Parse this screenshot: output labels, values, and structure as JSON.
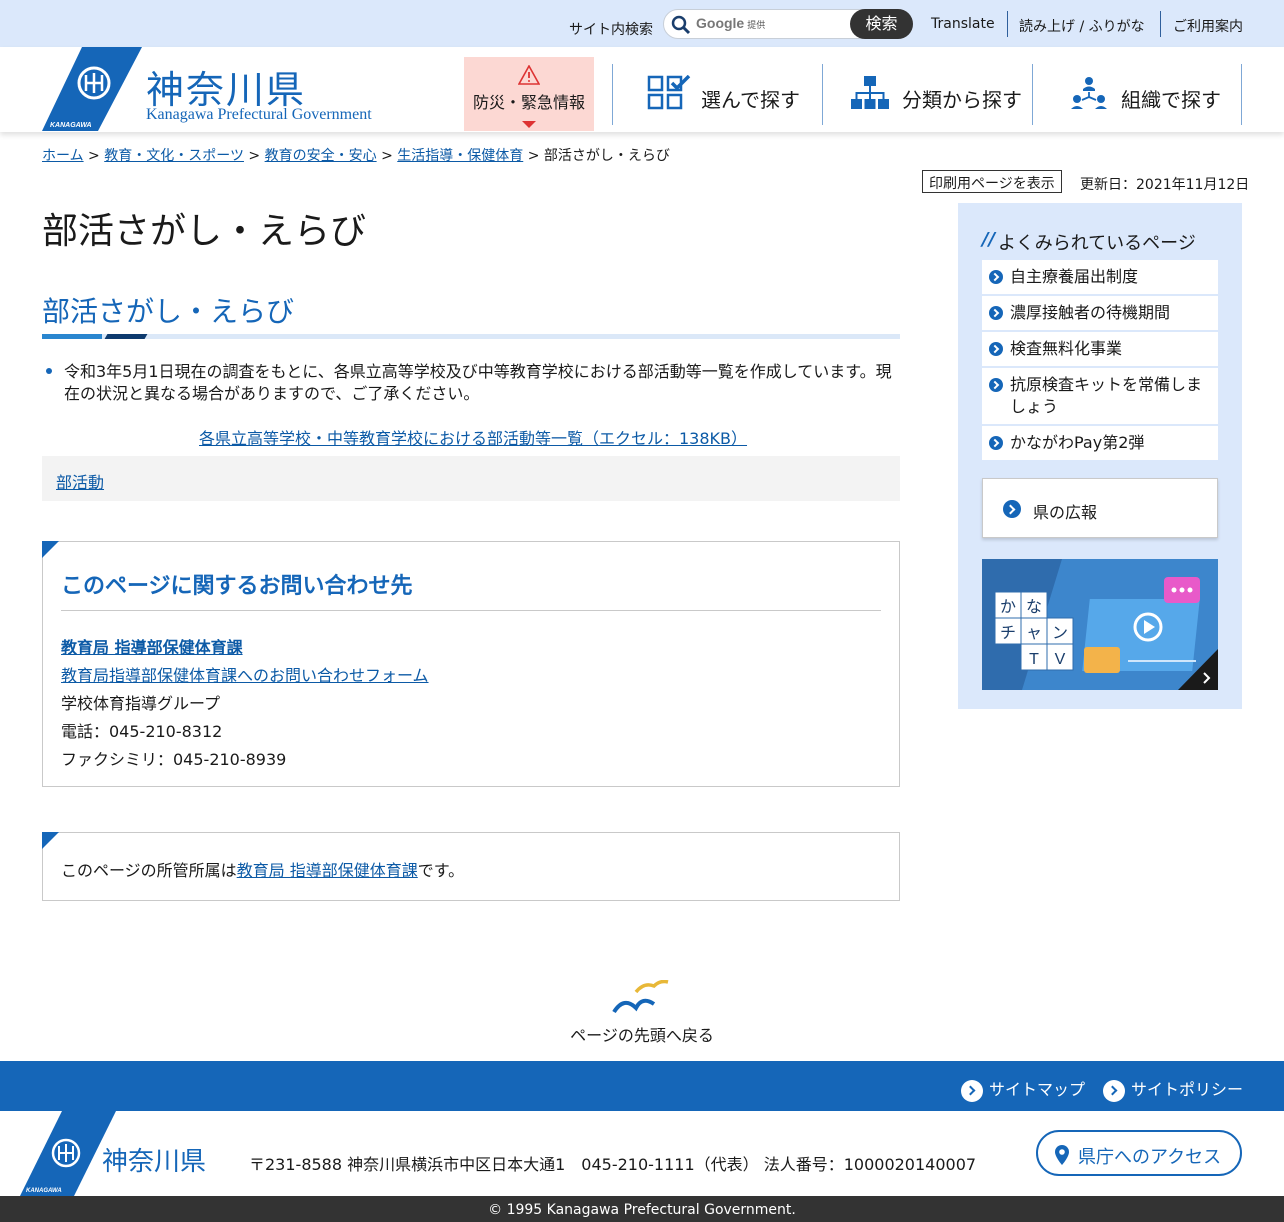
{
  "topbar": {
    "search_label": "サイト内検索",
    "search_provider": "Google",
    "search_provider_sub": "提供",
    "search_button": "検索",
    "translate": "Translate",
    "readaloud": "読み上げ / ふりがな",
    "guide": "ご利用案内"
  },
  "header": {
    "logo_jp": "神奈川県",
    "logo_en": "Kanagawa Prefectural Government",
    "logo_small": "KANAGAWA",
    "emergency": "防災・緊急情報",
    "nav": [
      {
        "label": "選んで探す",
        "icon": "checklist-icon"
      },
      {
        "label": "分類から探す",
        "icon": "hierarchy-icon"
      },
      {
        "label": "組織で探す",
        "icon": "organization-icon"
      }
    ]
  },
  "breadcrumb": {
    "items": [
      "ホーム",
      "教育・文化・スポーツ",
      "教育の安全・安心",
      "生活指導・保健体育"
    ],
    "current": "部活さがし・えらび",
    "sep": ">"
  },
  "meta": {
    "print": "印刷用ページを表示",
    "updated": "更新日：2021年11月12日"
  },
  "main": {
    "title": "部活さがし・えらび",
    "heading": "部活さがし・えらび",
    "bullet": "令和3年5月1日現在の調査をもとに、各県立高等学校及び中等教育学校における部活動等一覧を作成しています。現在の状況と異なる場合がありますので、ご了承ください。",
    "excel_link": "各県立高等学校・中等教育学校における部活動等一覧（エクセル：138KB）",
    "tag": "部活動"
  },
  "contact": {
    "heading": "このページに関するお問い合わせ先",
    "dept": "教育局 指導部保健体育課",
    "form_link": "教育局指導部保健体育課へのお問い合わせフォーム",
    "group": "学校体育指導グループ",
    "tel": "電話：045-210-8312",
    "fax": "ファクシミリ：045-210-8939"
  },
  "owner": {
    "prefix": "このページの所管所属は",
    "link": "教育局 指導部保健体育課",
    "suffix": "です。"
  },
  "side": {
    "heading": "よくみられているページ",
    "items": [
      "自主療養届出制度",
      "濃厚接触者の待機期間",
      "検査無料化事業",
      "抗原検査キットを常備しましょう",
      "かながわPay第2弾"
    ],
    "koho": "県の広報",
    "tv": {
      "line1a": "か",
      "line1b": "な",
      "line2a": "チ",
      "line2b": "ャ",
      "line2c": "ン",
      "line3a": "T",
      "line3b": "V"
    }
  },
  "pagetop": "ページの先頭へ戻る",
  "footer": {
    "sitemap": "サイトマップ",
    "policy": "サイトポリシー",
    "logo_jp": "神奈川県",
    "logo_small": "KANAGAWA",
    "address": "〒231-8588 神奈川県横浜市中区日本大通1　045-210-1111（代表）  法人番号：1000020140007",
    "access": "県庁へのアクセス",
    "copyright": "© 1995 Kanagawa Prefectural Government."
  },
  "colors": {
    "brand": "#1566b8",
    "topbar": "#dbe8fb",
    "emergency": "#fcd8d3"
  }
}
